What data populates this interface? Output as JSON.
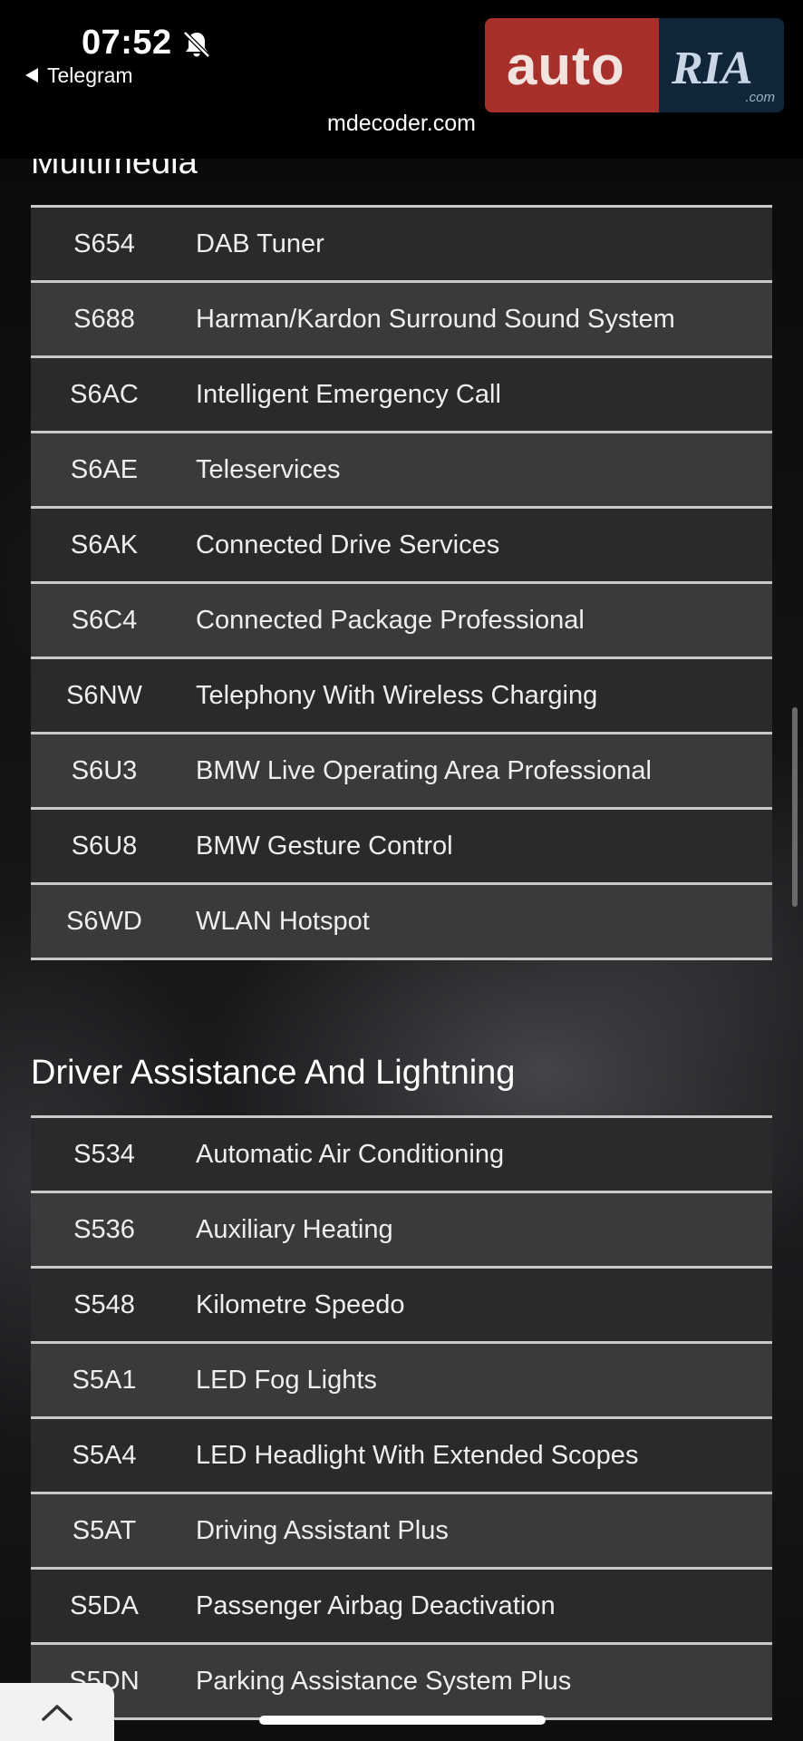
{
  "status_bar": {
    "time": "07:52",
    "back_app": "Telegram",
    "url": "mdecoder.com"
  },
  "ad": {
    "brand_left": "auto",
    "brand_right": "RIA",
    "brand_suffix": ".com"
  },
  "sections": [
    {
      "title": "Multimedia",
      "rows": [
        {
          "code": "S654",
          "desc": "DAB Tuner"
        },
        {
          "code": "S688",
          "desc": "Harman/Kardon Surround Sound System"
        },
        {
          "code": "S6AC",
          "desc": "Intelligent Emergency Call"
        },
        {
          "code": "S6AE",
          "desc": "Teleservices"
        },
        {
          "code": "S6AK",
          "desc": "Connected Drive Services"
        },
        {
          "code": "S6C4",
          "desc": "Connected Package Professional"
        },
        {
          "code": "S6NW",
          "desc": "Telephony With Wireless Charging"
        },
        {
          "code": "S6U3",
          "desc": "BMW Live Operating Area Professional"
        },
        {
          "code": "S6U8",
          "desc": "BMW Gesture Control"
        },
        {
          "code": "S6WD",
          "desc": "WLAN Hotspot"
        }
      ]
    },
    {
      "title": "Driver Assistance And Lightning",
      "rows": [
        {
          "code": "S534",
          "desc": "Automatic Air Conditioning"
        },
        {
          "code": "S536",
          "desc": "Auxiliary Heating"
        },
        {
          "code": "S548",
          "desc": "Kilometre Speedo"
        },
        {
          "code": "S5A1",
          "desc": "LED Fog Lights"
        },
        {
          "code": "S5A4",
          "desc": "LED Headlight With Extended Scopes"
        },
        {
          "code": "S5AT",
          "desc": "Driving Assistant Plus"
        },
        {
          "code": "S5DA",
          "desc": "Passenger Airbag Deactivation"
        },
        {
          "code": "S5DN",
          "desc": "Parking Assistance System Plus"
        }
      ]
    }
  ],
  "icons": {
    "mute": "bell-slash-icon",
    "back": "back-arrow-icon",
    "scroll_top": "chevron-up-icon"
  }
}
